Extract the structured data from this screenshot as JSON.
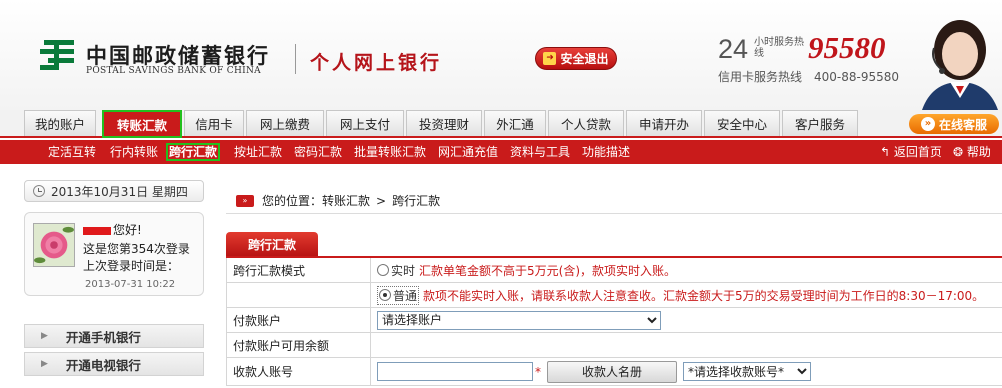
{
  "header": {
    "bank_name_cn": "中国邮政储蓄银行",
    "bank_name_en": "POSTAL SAVINGS BANK OF CHINA",
    "product_name": "个人网上银行",
    "logout_label": "安全退出",
    "hotline_24": "24",
    "hotline_label": "小时服务热线",
    "hotline_number": "95580",
    "credit_hotline_label": "信用卡服务热线",
    "credit_hotline_number": "400-88-95580",
    "brand_color": "#c91b1b"
  },
  "main_nav": {
    "tabs": [
      {
        "label": "我的账户"
      },
      {
        "label": "转账汇款",
        "active": true
      },
      {
        "label": "信用卡"
      },
      {
        "label": "网上缴费"
      },
      {
        "label": "网上支付"
      },
      {
        "label": "投资理财"
      },
      {
        "label": "外汇通"
      },
      {
        "label": "个人贷款"
      },
      {
        "label": "申请开办"
      },
      {
        "label": "安全中心"
      },
      {
        "label": "客户服务"
      }
    ],
    "online_service_label": "在线客服"
  },
  "sub_nav": {
    "items": [
      {
        "label": "定活互转"
      },
      {
        "label": "行内转账"
      },
      {
        "label": "跨行汇款",
        "active": true
      },
      {
        "label": "按址汇款"
      },
      {
        "label": "密码汇款"
      },
      {
        "label": "批量转账汇款"
      },
      {
        "label": "网汇通充值"
      },
      {
        "label": "资料与工具"
      },
      {
        "label": "功能描述"
      }
    ],
    "back_home_label": "返回首页",
    "help_label": "帮助"
  },
  "sidebar": {
    "date_text": "2013年10月31日 星期四",
    "greeting_suffix": "您好!",
    "login_count_text": "这是您第354次登录",
    "last_login_label": "上次登录时间是：",
    "last_login_time": "2013-07-31 10:22",
    "links": [
      {
        "label": "开通手机银行"
      },
      {
        "label": "开通电视银行"
      }
    ]
  },
  "breadcrumb": {
    "prefix": "您的位置：",
    "level1": "转账汇款",
    "separator": ">",
    "level2": "跨行汇款"
  },
  "form": {
    "tab_label": "跨行汇款",
    "mode_label": "跨行汇款模式",
    "mode_options": [
      {
        "label": "实时",
        "note": "汇款单笔金额不高于5万元(含)，款项实时入账。",
        "checked": false
      },
      {
        "label": "普通",
        "note": "款项不能实时入账，请联系收款人注意查收。汇款金额大于5万的交易受理时间为工作日的8:30－17:00。",
        "checked": true
      }
    ],
    "pay_account_label": "付款账户",
    "pay_account_selected": "请选择账户",
    "available_balance_label": "付款账户可用余额",
    "available_balance_value": "",
    "payee_account_label": "收款人账号",
    "payee_account_value": "",
    "required_mark": "*",
    "payee_book_button": "收款人名册",
    "payee_account_select": "*请选择收款账号*"
  }
}
